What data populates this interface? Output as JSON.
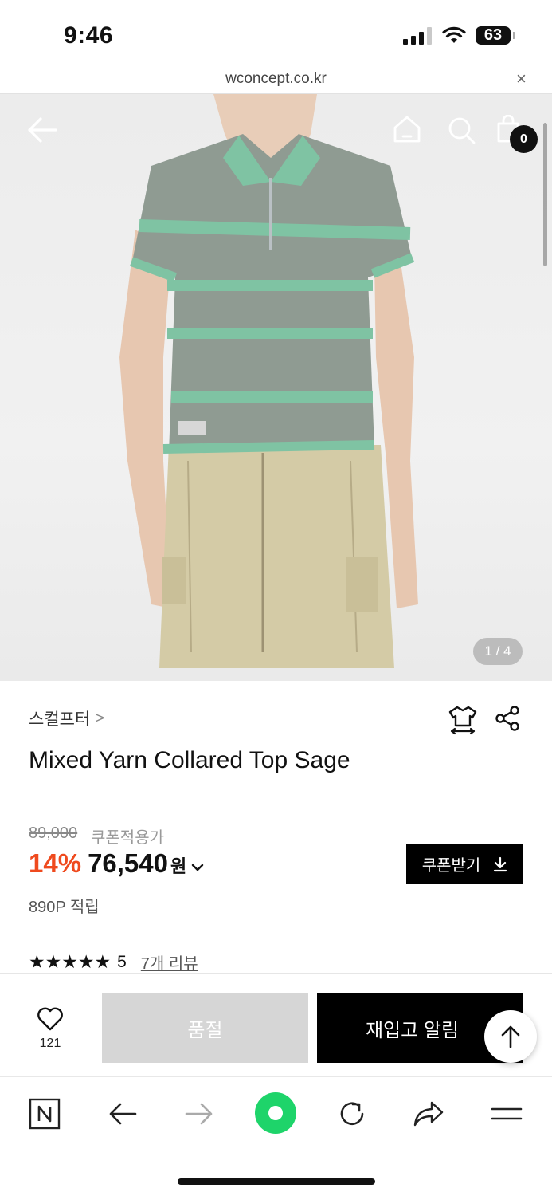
{
  "status_bar": {
    "time": "9:46",
    "battery": "63"
  },
  "browser": {
    "url": "wconcept.co.kr",
    "close_symbol": "×"
  },
  "header": {
    "cart_count": "0"
  },
  "gallery": {
    "counter": "1 / 4",
    "current": 1,
    "total": 4
  },
  "product": {
    "brand": "스컬프터",
    "brand_chevron": ">",
    "name": "Mixed Yarn Collared Top Sage",
    "original_price": "89,000",
    "coupon_note": "쿠폰적용가",
    "discount": "14%",
    "sale_price": "76,540",
    "currency": "원",
    "points": "890P 적립",
    "stars": "★★★★★",
    "rating": "5",
    "reviews": "7개 리뷰"
  },
  "coupon_button": {
    "label": "쿠폰받기"
  },
  "purchase_bar": {
    "wish_count": "121",
    "soldout_label": "품절",
    "restock_label": "재입고 알림"
  },
  "colors": {
    "accent": "#ef4a1e",
    "primary": "#000000",
    "disabled": "#d6d6d6",
    "naver_green": "#1ed46a"
  }
}
